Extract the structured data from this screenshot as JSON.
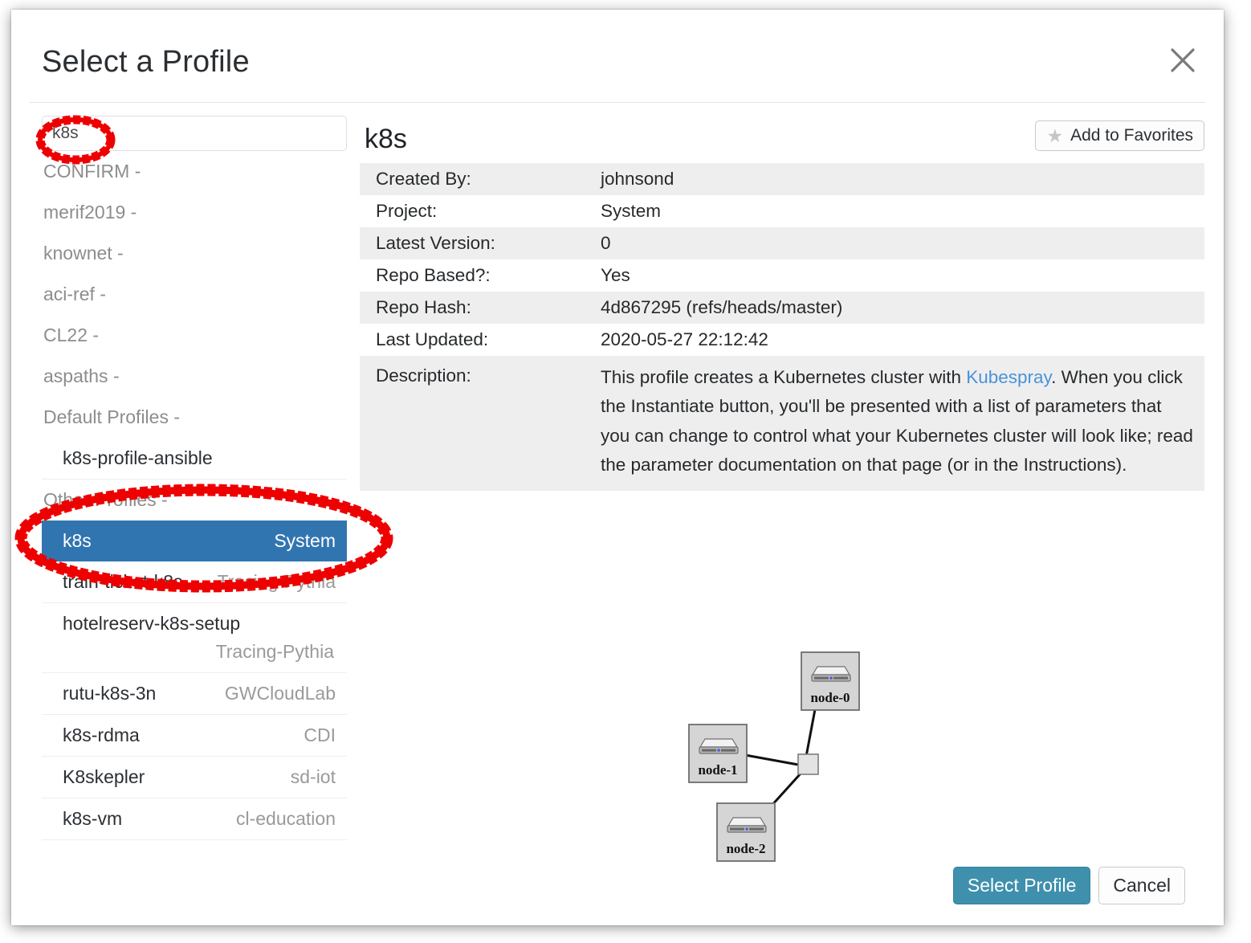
{
  "dialog": {
    "title": "Select a Profile",
    "close_icon": "close-icon"
  },
  "search": {
    "value": "k8s",
    "placeholder": ""
  },
  "profile_list": {
    "groups": [
      {
        "label": "CONFIRM -"
      },
      {
        "label": "merif2019 -"
      },
      {
        "label": "knownet -"
      },
      {
        "label": "aci-ref -"
      },
      {
        "label": "CL22 -"
      },
      {
        "label": "aspaths -"
      },
      {
        "label": "Default Profiles -"
      }
    ],
    "default_profiles": [
      {
        "name": "k8s-profile-ansible",
        "project": ""
      }
    ],
    "other_label": "Other Profiles -",
    "other_profiles": [
      {
        "name": "k8s",
        "project": "System",
        "selected": true,
        "wrap": false
      },
      {
        "name": "train-ticket-k8s",
        "project": "Tracing-Pythia",
        "selected": false,
        "wrap": false
      },
      {
        "name": "hotelreserv-k8s-setup",
        "project": "Tracing-Pythia",
        "selected": false,
        "wrap": true
      },
      {
        "name": "rutu-k8s-3n",
        "project": "GWCloudLab",
        "selected": false,
        "wrap": false
      },
      {
        "name": "k8s-rdma",
        "project": "CDI",
        "selected": false,
        "wrap": false
      },
      {
        "name": "K8skepler",
        "project": "sd-iot",
        "selected": false,
        "wrap": false
      },
      {
        "name": "k8s-vm",
        "project": "cl-education",
        "selected": false,
        "wrap": false
      }
    ]
  },
  "detail": {
    "favorites_button": "Add to Favorites",
    "star_icon": "star-icon",
    "title": "k8s",
    "rows": [
      {
        "key": "Created By:",
        "value": "johnsond"
      },
      {
        "key": "Project:",
        "value": "System"
      },
      {
        "key": "Latest Version:",
        "value": "0"
      },
      {
        "key": "Repo Based?:",
        "value": "Yes"
      },
      {
        "key": "Repo Hash:",
        "value": "4d867295 (refs/heads/master)"
      },
      {
        "key": "Last Updated:",
        "value": "2020-05-27 22:12:42"
      }
    ],
    "description": {
      "key": "Description:",
      "part1": "This profile creates a Kubernetes cluster with ",
      "link": "Kubespray",
      "part2": ". When you click the Instantiate button, you'll be presented with a list of parameters that you can change to control what your Kubernetes cluster will look like; read the parameter documentation on that page (or in the Instructions)."
    }
  },
  "topology": {
    "nodes": [
      {
        "label": "node-0"
      },
      {
        "label": "node-1"
      },
      {
        "label": "node-2"
      }
    ],
    "lan_label": ""
  },
  "footer": {
    "select_label": "Select Profile",
    "cancel_label": "Cancel"
  },
  "colors": {
    "primary_button": "#3e90ad",
    "selected_row": "#3175b0",
    "link": "#4a93d9",
    "annotation": "#ee0000",
    "table_stripe": "#eeeeee"
  }
}
